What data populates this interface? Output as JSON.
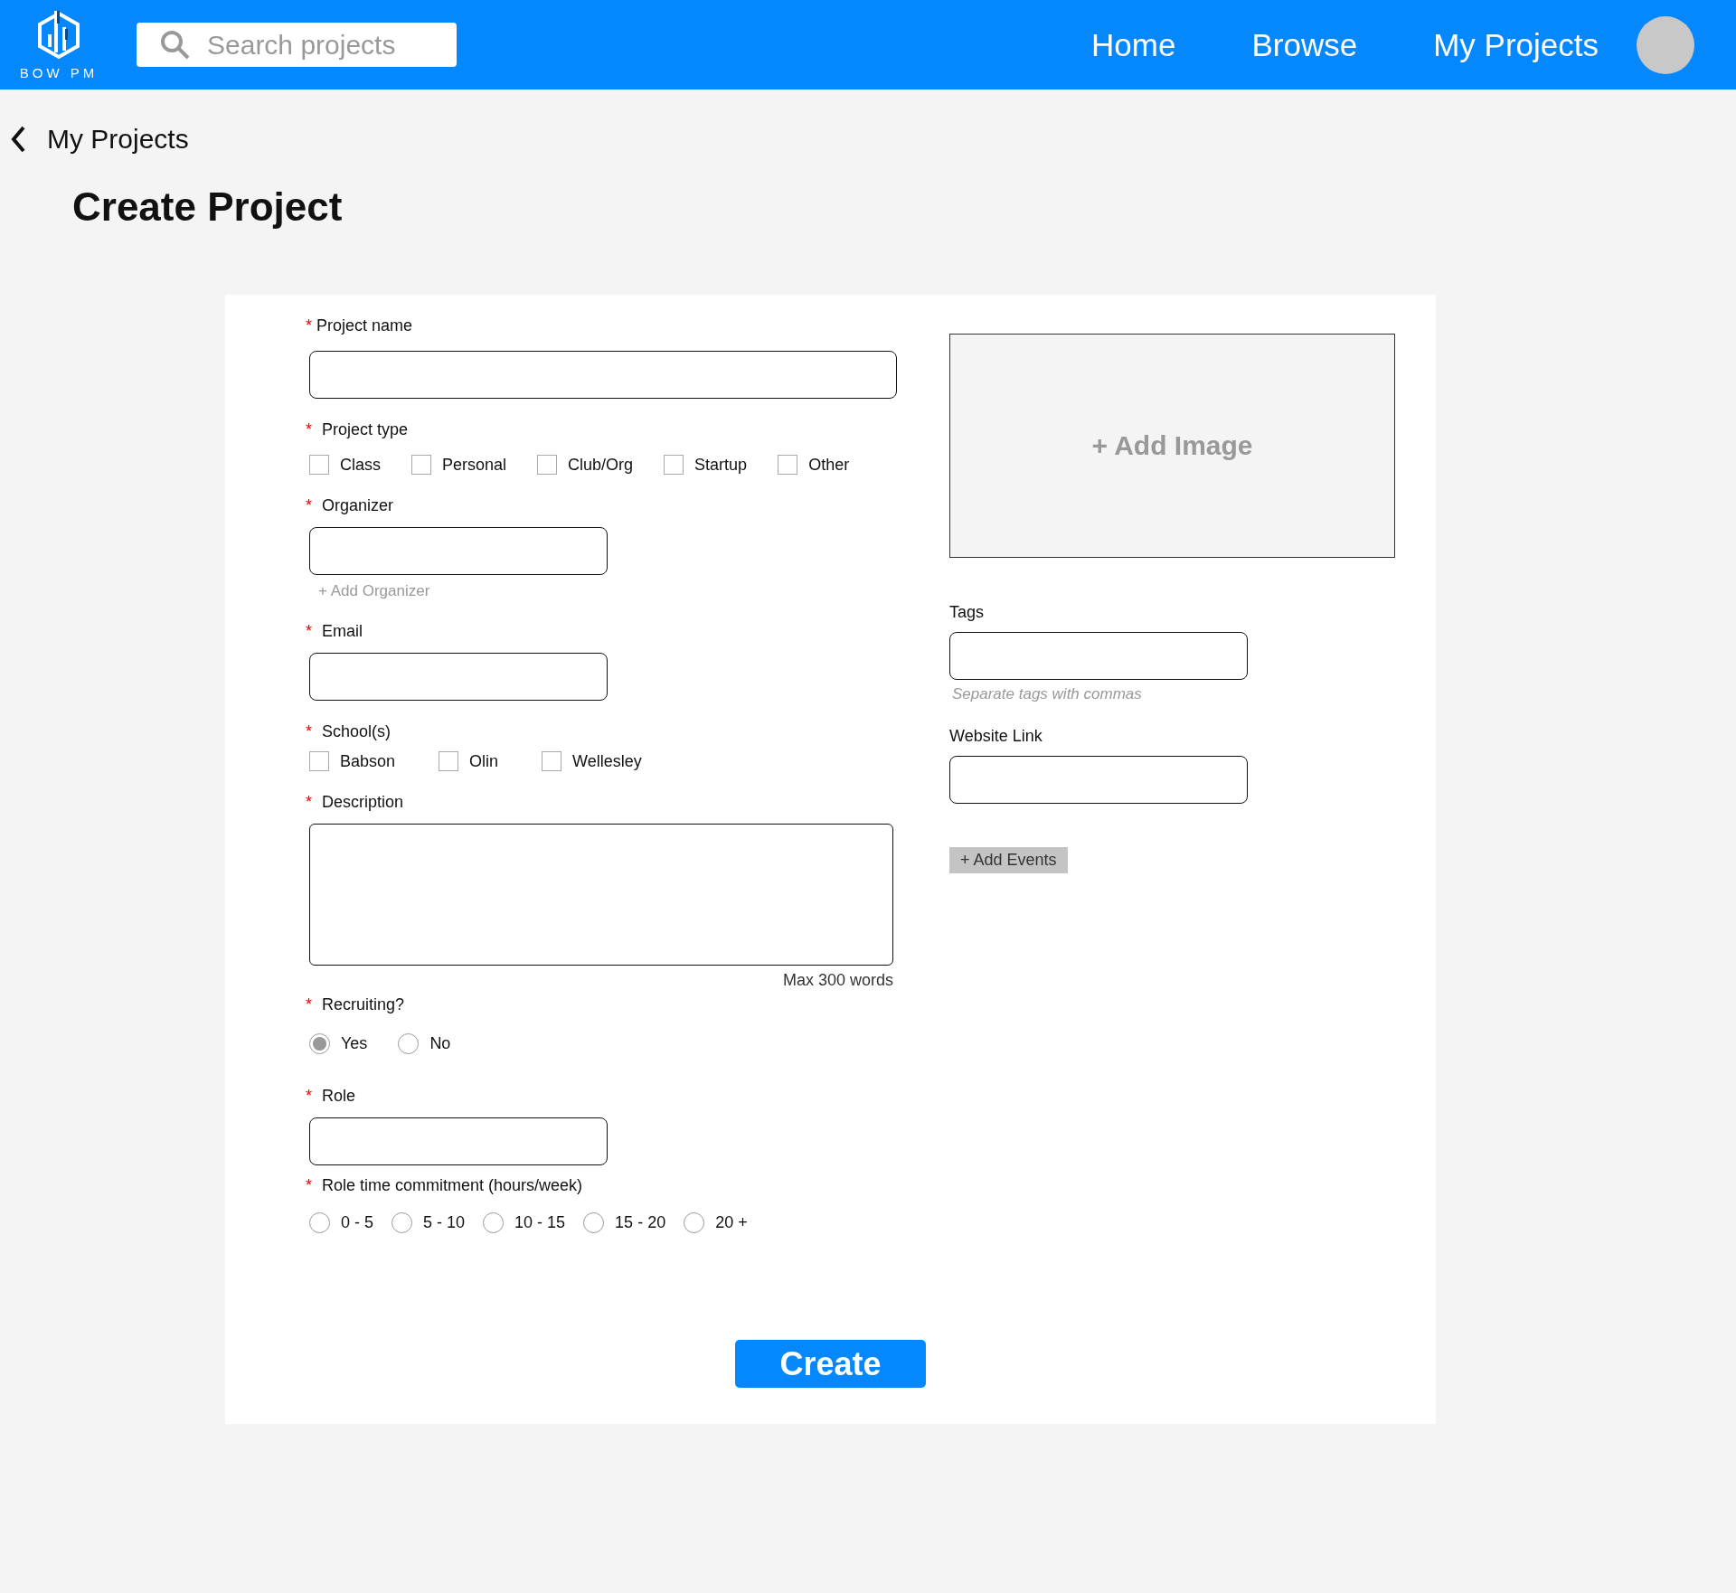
{
  "header": {
    "logo_text": "BOW PM",
    "search": {
      "placeholder": "Search projects"
    },
    "nav": [
      {
        "label": "Home"
      },
      {
        "label": "Browse"
      },
      {
        "label": "My Projects"
      }
    ]
  },
  "back_link": "My Projects",
  "title": "Create Project",
  "form": {
    "left": [
      {
        "kind": "wide_text",
        "label": "Project name",
        "required_mark": "*"
      },
      {
        "kind": "checkboxes",
        "label": "Project type",
        "required_mark": "*",
        "options": [
          {
            "label": "Class",
            "checked": false
          },
          {
            "label": "Personal",
            "checked": false
          },
          {
            "label": "Club/Org",
            "checked": false
          },
          {
            "label": "Startup",
            "checked": false
          },
          {
            "label": "Other",
            "checked": false
          }
        ]
      },
      {
        "kind": "text",
        "label": "Organizer",
        "required_mark": "*",
        "link": "+ Add Organizer"
      },
      {
        "kind": "text",
        "label": "Email",
        "required_mark": "*"
      },
      {
        "kind": "checkboxes",
        "label": "School(s)",
        "required_mark": "*",
        "options": [
          {
            "label": "Babson",
            "checked": false
          },
          {
            "label": "Olin",
            "checked": false
          },
          {
            "label": "Wellesley",
            "checked": false
          }
        ]
      },
      {
        "kind": "textarea",
        "label": "Description",
        "required_mark": "*",
        "note": "Max 300 words"
      },
      {
        "kind": "radios",
        "label": "Recruiting?",
        "required_mark": "*",
        "options": [
          {
            "label": "Yes",
            "selected": true
          },
          {
            "label": "No",
            "selected": false
          }
        ]
      },
      {
        "kind": "text",
        "label": "Role",
        "required_mark": "*"
      },
      {
        "kind": "radios",
        "label": "Role time commitment (hours/week)",
        "required_mark": "*",
        "options": [
          {
            "label": "0 - 5",
            "selected": false
          },
          {
            "label": "5 - 10",
            "selected": false
          },
          {
            "label": "10 - 15",
            "selected": false
          },
          {
            "label": "15 - 20",
            "selected": false
          },
          {
            "label": "20 +",
            "selected": false
          }
        ]
      }
    ],
    "image_drop": "+ Add Image",
    "tags": {
      "label": "Tags",
      "hint": "Separate tags with commas"
    },
    "website": {
      "label": "Website Link"
    },
    "add_events": "+ Add Events",
    "submit": "Create"
  }
}
